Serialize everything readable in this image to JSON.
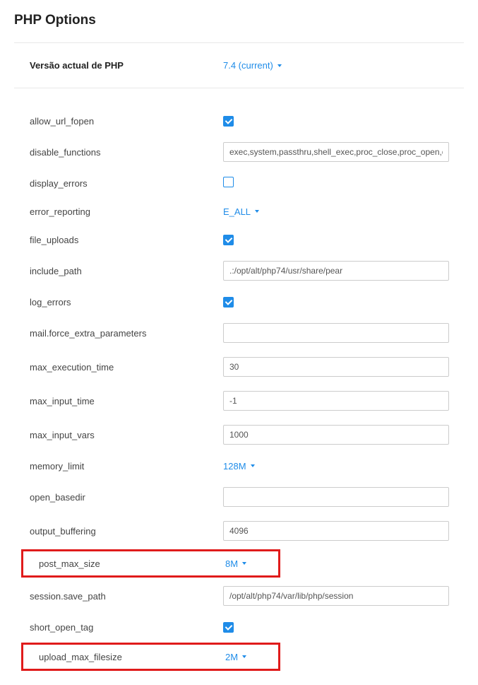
{
  "title": "PHP Options",
  "version": {
    "label": "Versão actual de PHP",
    "value": "7.4 (current)"
  },
  "options": {
    "allow_url_fopen": {
      "label": "allow_url_fopen",
      "type": "checkbox",
      "checked": true
    },
    "disable_functions": {
      "label": "disable_functions",
      "type": "text",
      "value": "exec,system,passthru,shell_exec,proc_close,proc_open,dl,popen,"
    },
    "display_errors": {
      "label": "display_errors",
      "type": "checkbox",
      "checked": false
    },
    "error_reporting": {
      "label": "error_reporting",
      "type": "dropdown",
      "value": "E_ALL"
    },
    "file_uploads": {
      "label": "file_uploads",
      "type": "checkbox",
      "checked": true
    },
    "include_path": {
      "label": "include_path",
      "type": "text",
      "value": ".:/opt/alt/php74/usr/share/pear"
    },
    "log_errors": {
      "label": "log_errors",
      "type": "checkbox",
      "checked": true
    },
    "mail_force_extra_parameters": {
      "label": "mail.force_extra_parameters",
      "type": "text",
      "value": ""
    },
    "max_execution_time": {
      "label": "max_execution_time",
      "type": "text",
      "value": "30"
    },
    "max_input_time": {
      "label": "max_input_time",
      "type": "text",
      "value": "-1"
    },
    "max_input_vars": {
      "label": "max_input_vars",
      "type": "text",
      "value": "1000"
    },
    "memory_limit": {
      "label": "memory_limit",
      "type": "dropdown",
      "value": "128M"
    },
    "open_basedir": {
      "label": "open_basedir",
      "type": "text",
      "value": ""
    },
    "output_buffering": {
      "label": "output_buffering",
      "type": "text",
      "value": "4096"
    },
    "post_max_size": {
      "label": "post_max_size",
      "type": "dropdown",
      "value": "8M",
      "highlighted": true
    },
    "session_save_path": {
      "label": "session.save_path",
      "type": "text",
      "value": "/opt/alt/php74/var/lib/php/session"
    },
    "short_open_tag": {
      "label": "short_open_tag",
      "type": "checkbox",
      "checked": true
    },
    "upload_max_filesize": {
      "label": "upload_max_filesize",
      "type": "dropdown",
      "value": "2M",
      "highlighted": true
    }
  }
}
